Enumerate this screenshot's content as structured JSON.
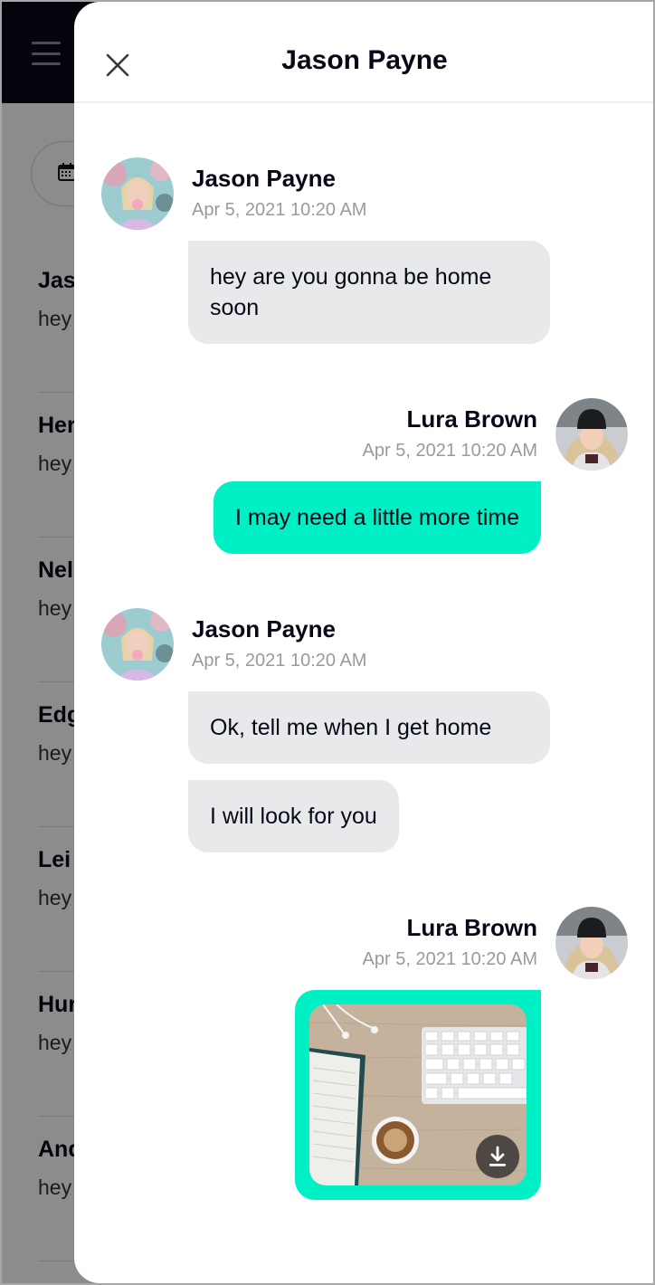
{
  "background_app": {
    "menu_icon": "hamburger-icon",
    "date_filter_icon": "calendar-icon",
    "conversations": [
      {
        "name_visible": "Jas",
        "preview_visible": "hey"
      },
      {
        "name_visible": "Her",
        "preview_visible": "hey"
      },
      {
        "name_visible": "Nel",
        "preview_visible": "hey"
      },
      {
        "name_visible": "Edg",
        "preview_visible": "hey"
      },
      {
        "name_visible": "Lei",
        "preview_visible": "hey"
      },
      {
        "name_visible": "Hur",
        "preview_visible": "hey"
      },
      {
        "name_visible": "And",
        "preview_visible": "hey"
      }
    ]
  },
  "chat": {
    "title": "Jason Payne",
    "close_icon": "close-icon",
    "messages": [
      {
        "direction": "in",
        "sender": "Jason Payne",
        "time": "Apr 5, 2021 10:20 AM",
        "texts": [
          "hey are you gonna be home soon"
        ]
      },
      {
        "direction": "out",
        "sender": "Lura Brown",
        "time": "Apr 5, 2021 10:20 AM",
        "texts": [
          "I may need a little more time"
        ]
      },
      {
        "direction": "in",
        "sender": "Jason Payne",
        "time": "Apr 5, 2021 10:20 AM",
        "texts": [
          "Ok, tell me when I get home",
          "I will look for you"
        ]
      },
      {
        "direction": "out",
        "sender": "Lura Brown",
        "time": "Apr 5, 2021 10:20 AM",
        "attachment": {
          "type": "image",
          "description": "desk with keyboard, notebook, earphones and coffee",
          "action_icon": "download-icon"
        }
      }
    ]
  },
  "colors": {
    "accent": "#00efc4",
    "incoming_bubble": "#e8e9eb",
    "text_dark": "#060817",
    "timestamp": "#9a9a9a",
    "topbar": "#060817"
  }
}
